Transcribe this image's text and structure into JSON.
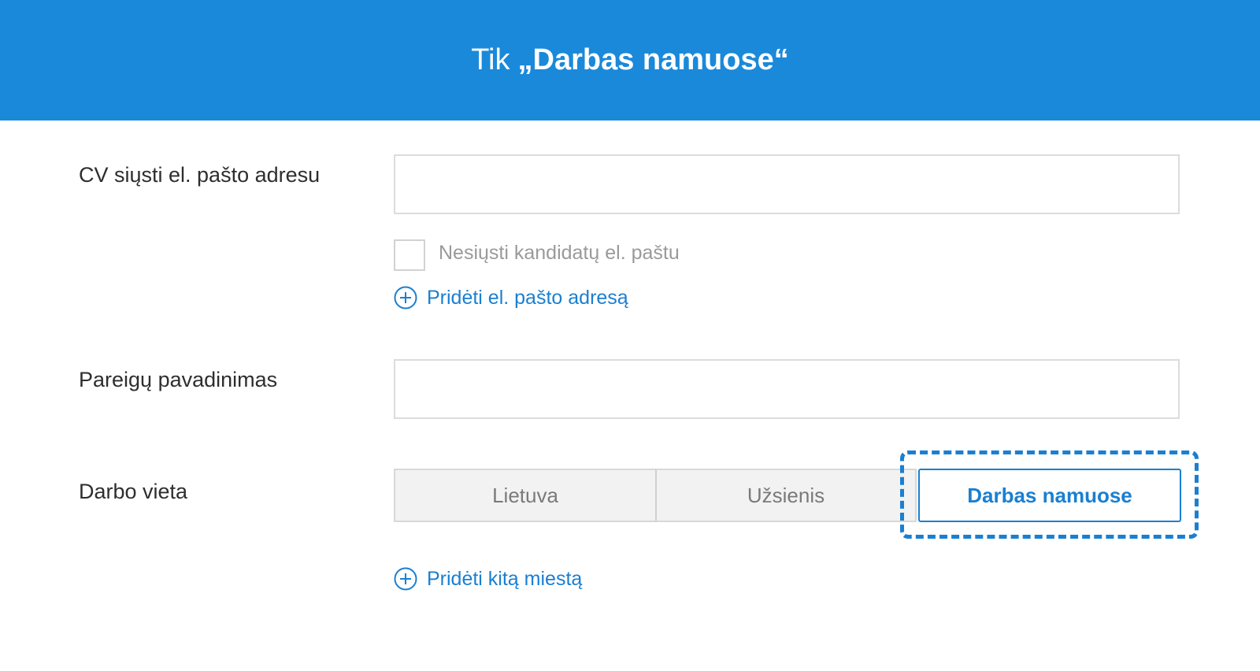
{
  "header": {
    "prefix": "Tik",
    "title": "„Darbas namuose“"
  },
  "form": {
    "email_label": "CV siųsti el. pašto adresu",
    "email_value": "",
    "no_email_checkbox_label": "Nesiųsti kandidatų el. paštu",
    "no_email_checked": false,
    "add_email_link": "Pridėti el. pašto adresą",
    "position_label": "Pareigų pavadinimas",
    "position_value": "",
    "workplace_label": "Darbo vieta",
    "workplace_options": [
      "Lietuva",
      "Užsienis",
      "Darbas namuose"
    ],
    "workplace_selected": "Darbas namuose",
    "add_city_link": "Pridėti kitą miestą"
  },
  "colors": {
    "header_bg": "#1a89da",
    "accent": "#1a7fd1"
  },
  "icons": {
    "add": "plus-circle-icon"
  }
}
